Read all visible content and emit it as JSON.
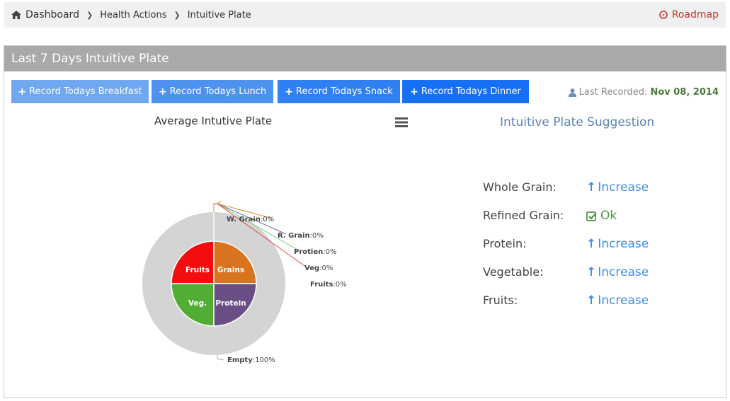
{
  "breadcrumb": {
    "items": [
      "Dashboard",
      "Health Actions",
      "Intuitive Plate"
    ],
    "roadmap": "Roadmap"
  },
  "panel": {
    "title": "Last 7 Days Intuitive Plate"
  },
  "buttons": {
    "breakfast": "Record Todays Breakfast",
    "lunch": "Record Todays Lunch",
    "snack": "Record Todays Snack",
    "dinner": "Record Todays Dinner",
    "plus": "+"
  },
  "last_recorded": {
    "label": "Last Recorded:",
    "date": "Nov 08, 2014"
  },
  "chart": {
    "title": "Average Intutive Plate",
    "inner_labels": [
      "Fruits",
      "Grains",
      "Veg.",
      "Protein"
    ],
    "callouts": [
      {
        "name": "W. Grain",
        "value": ":0%"
      },
      {
        "name": "R. Grain",
        "value": ":0%"
      },
      {
        "name": "Protien",
        "value": ":0%"
      },
      {
        "name": "Veg",
        "value": ":0%"
      },
      {
        "name": "Fruits",
        "value": ":0%"
      }
    ],
    "empty": {
      "name": "Empty",
      "value": ":100%"
    }
  },
  "chart_data": {
    "type": "pie",
    "title": "Average Intutive Plate",
    "inner_quadrants": [
      {
        "label": "Fruits",
        "color": "#f20e0e"
      },
      {
        "label": "Grains",
        "color": "#d8731e"
      },
      {
        "label": "Veg.",
        "color": "#51ad33"
      },
      {
        "label": "Protein",
        "color": "#6a4e86"
      }
    ],
    "slices": [
      {
        "label": "W. Grain",
        "value": 0,
        "color": "#d8731e"
      },
      {
        "label": "R. Grain",
        "value": 0,
        "color": "#7a62a3"
      },
      {
        "label": "Protien",
        "value": 0,
        "color": "#6ea8e0"
      },
      {
        "label": "Veg",
        "value": 0,
        "color": "#6ed06e"
      },
      {
        "label": "Fruits",
        "value": 0,
        "color": "#e64444"
      },
      {
        "label": "Empty",
        "value": 100,
        "color": "#d4d4d4"
      }
    ],
    "units": "%"
  },
  "suggestion": {
    "title": "Intuitive Plate Suggestion",
    "rows": [
      {
        "label": "Whole Grain:",
        "value": "Increase",
        "status": "increase"
      },
      {
        "label": "Refined Grain:",
        "value": "Ok",
        "status": "ok"
      },
      {
        "label": "Protein:",
        "value": "Increase",
        "status": "increase"
      },
      {
        "label": "Vegetable:",
        "value": "Increase",
        "status": "increase"
      },
      {
        "label": "Fruits:",
        "value": "Increase",
        "status": "increase"
      }
    ],
    "arrow_glyph": "🠕"
  },
  "icons": {
    "home": "home-icon",
    "roadmap": "compass-icon",
    "user": "user-icon",
    "menu": "hamburger-menu-icon",
    "check": "check-square-icon",
    "arrow": "arrow-up-icon"
  },
  "colors": {
    "accent_red": "#c0392b",
    "increase_blue": "#3e8ee8",
    "ok_green": "#4e9a43",
    "date_green": "#4c7a3b"
  }
}
